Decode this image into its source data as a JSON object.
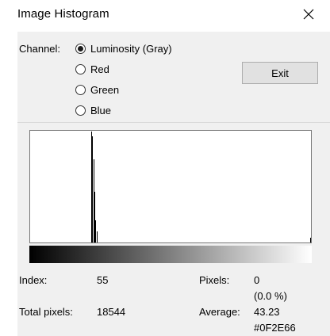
{
  "window": {
    "title": "Image Histogram",
    "close_icon": "close-icon"
  },
  "channel": {
    "label": "Channel:",
    "options": [
      {
        "label": "Luminosity (Gray)",
        "selected": true
      },
      {
        "label": "Red",
        "selected": false
      },
      {
        "label": "Green",
        "selected": false
      },
      {
        "label": "Blue",
        "selected": false
      }
    ]
  },
  "exit_label": "Exit",
  "histogram": {
    "levels": [
      {
        "index": 55,
        "fraction": 1.0
      },
      {
        "index": 56,
        "fraction": 0.96
      },
      {
        "index": 57,
        "fraction": 0.75
      },
      {
        "index": 58,
        "fraction": 0.46
      },
      {
        "index": 59,
        "fraction": 0.2
      },
      {
        "index": 60,
        "fraction": 0.1
      },
      {
        "index": 255,
        "fraction": 0.04
      }
    ],
    "gradient": [
      "#000000",
      "#ffffff"
    ]
  },
  "stats": {
    "index_label": "Index:",
    "index_value": "55",
    "pixels_label": "Pixels:",
    "pixels_value": "0",
    "pixels_percent": "(0.0 %)",
    "total_label": "Total pixels:",
    "total_value": "18544",
    "average_label": "Average:",
    "average_value": "43.23",
    "average_hex": "#0F2E66"
  }
}
